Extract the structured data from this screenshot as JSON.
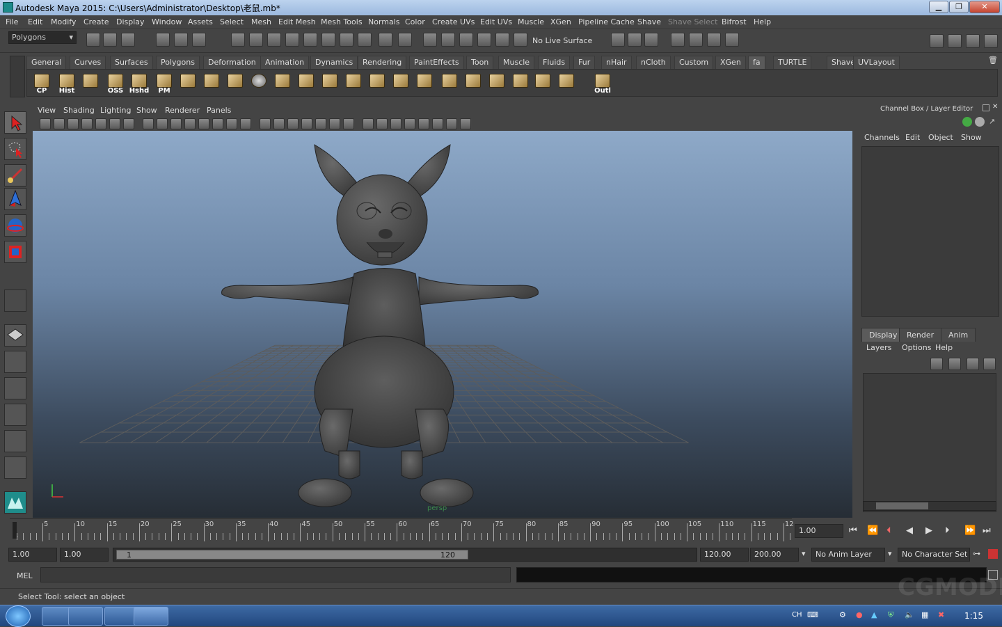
{
  "window": {
    "title": "Autodesk Maya 2015: C:\\Users\\Administrator\\Desktop\\老鼠.mb*",
    "min": "▁",
    "max": "❐",
    "close": "✕"
  },
  "menubar": [
    "File",
    "Edit",
    "Modify",
    "Create",
    "Display",
    "Window",
    "Assets",
    "Select",
    "Mesh",
    "Edit Mesh",
    "Mesh Tools",
    "Normals",
    "Color",
    "Create UVs",
    "Edit UVs",
    "Muscle",
    "XGen",
    "Pipeline Cache",
    "Shave",
    "Shave Select",
    "Bifrost",
    "Help"
  ],
  "status": {
    "mode": "Polygons",
    "live_surface": "No Live Surface"
  },
  "shelf_tabs": [
    "General",
    "Curves",
    "Surfaces",
    "Polygons",
    "Deformation",
    "Animation",
    "Dynamics",
    "Rendering",
    "PaintEffects",
    "Toon",
    "Muscle",
    "Fluids",
    "Fur",
    "nHair",
    "nCloth",
    "Custom",
    "XGen",
    "fa",
    "TURTLE",
    "Shave",
    "UVLayout"
  ],
  "shelf_active": "fa",
  "shelf_labels": [
    "CP",
    "Hist",
    "OSS",
    "Hshd",
    "PM",
    "Outl"
  ],
  "panel_menu": [
    "View",
    "Shading",
    "Lighting",
    "Show",
    "Renderer",
    "Panels"
  ],
  "viewport": {
    "camera": "persp"
  },
  "channel_box": {
    "title": "Channel Box / Layer Editor",
    "menu": [
      "Channels",
      "Edit",
      "Object",
      "Show"
    ]
  },
  "layer_editor": {
    "tabs": [
      "Display",
      "Render",
      "Anim"
    ],
    "menu": [
      "Layers",
      "Options",
      "Help"
    ]
  },
  "timeline": {
    "ticks": [
      "5",
      "10",
      "15",
      "20",
      "25",
      "30",
      "35",
      "40",
      "45",
      "50",
      "55",
      "60",
      "65",
      "70",
      "75",
      "80",
      "85",
      "90",
      "95",
      "100",
      "105",
      "110",
      "115",
      "12"
    ],
    "start_marker": "1",
    "current_time": "1.00"
  },
  "range": {
    "start": "1.00",
    "start2": "1.00",
    "range_start": "1",
    "range_end": "120",
    "end": "120.00",
    "end2": "200.00",
    "anim_layer": "No Anim Layer",
    "char_set": "No Character Set"
  },
  "command": {
    "label": "MEL"
  },
  "help_line": "Select Tool: select an object",
  "taskbar": {
    "lang": "CH",
    "clock": "1:15"
  },
  "watermark": "CGMODEL.CN",
  "colors": {
    "bg": "#444444",
    "viewport_top": "#8ea9c8",
    "viewport_bottom": "#262d35",
    "model": "#4a4a4a"
  }
}
